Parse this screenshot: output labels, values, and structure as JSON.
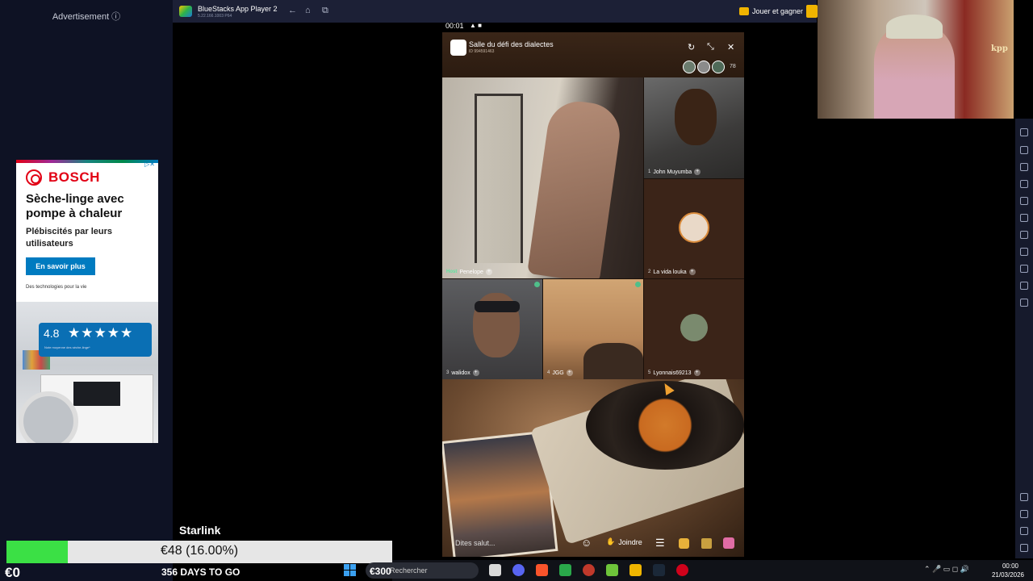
{
  "ad": {
    "label": "Advertisement ⓘ",
    "brand": "BOSCH",
    "headline": "Sèche-linge avec pompe à chaleur",
    "subline": "Plébiscités par leurs utilisateurs",
    "cta": "En savoir plus",
    "tagline": "Des technologies pour la vie",
    "rating": "4.8",
    "stars": "★★★★★",
    "rating_caption": "Note moyenne des sèche-linge*",
    "close": "▷✕"
  },
  "bluestacks": {
    "title": "BlueStacks App Player 2",
    "version": "5.22.166.1003 P64",
    "reward": "Jouer et gagner",
    "nav_back": "←",
    "nav_home": "⌂",
    "nav_recent": "⧉"
  },
  "phone": {
    "status_time": "00:01",
    "status_icons": "▲ ■"
  },
  "room": {
    "title": "Salle du défi des dialectes",
    "id": "ID 994591463",
    "viewer_count": "78",
    "refresh": "↻",
    "minimize": "⤡",
    "close": "✕"
  },
  "tiles": [
    {
      "num": "",
      "name": "Penelope",
      "host_badge": "Host"
    },
    {
      "num": "1",
      "name": "John Muyumba"
    },
    {
      "num": "2",
      "name": "La vida louka"
    },
    {
      "num": "3",
      "name": "walidox"
    },
    {
      "num": "4",
      "name": "JGG"
    },
    {
      "num": "5",
      "name": "Lyonnais69213"
    }
  ],
  "plus_glyph": "+",
  "bottom_bar": {
    "say_hi": "Dites salut...",
    "emoji": "☺",
    "join": "Joindre",
    "hand": "✋",
    "menu": "☰"
  },
  "webcam": {
    "jersey_text": "kpp"
  },
  "stream": {
    "sponsor": "Starlink",
    "goal_text": "€48 (16.00%)",
    "goal_progress": 0.16,
    "goal_start": "€0",
    "goal_end": "€300",
    "days_left": "356 DAYS TO GO"
  },
  "taskbar": {
    "search": "Rechercher",
    "clock_time": "00:00",
    "clock_date": "21/03/2026",
    "tray": "⌃  🎤  ▭  ◻  🔊"
  },
  "colors": {
    "progress_fill": "#3be045",
    "bosch_red": "#e20015",
    "bosch_blue": "#007bc0"
  }
}
